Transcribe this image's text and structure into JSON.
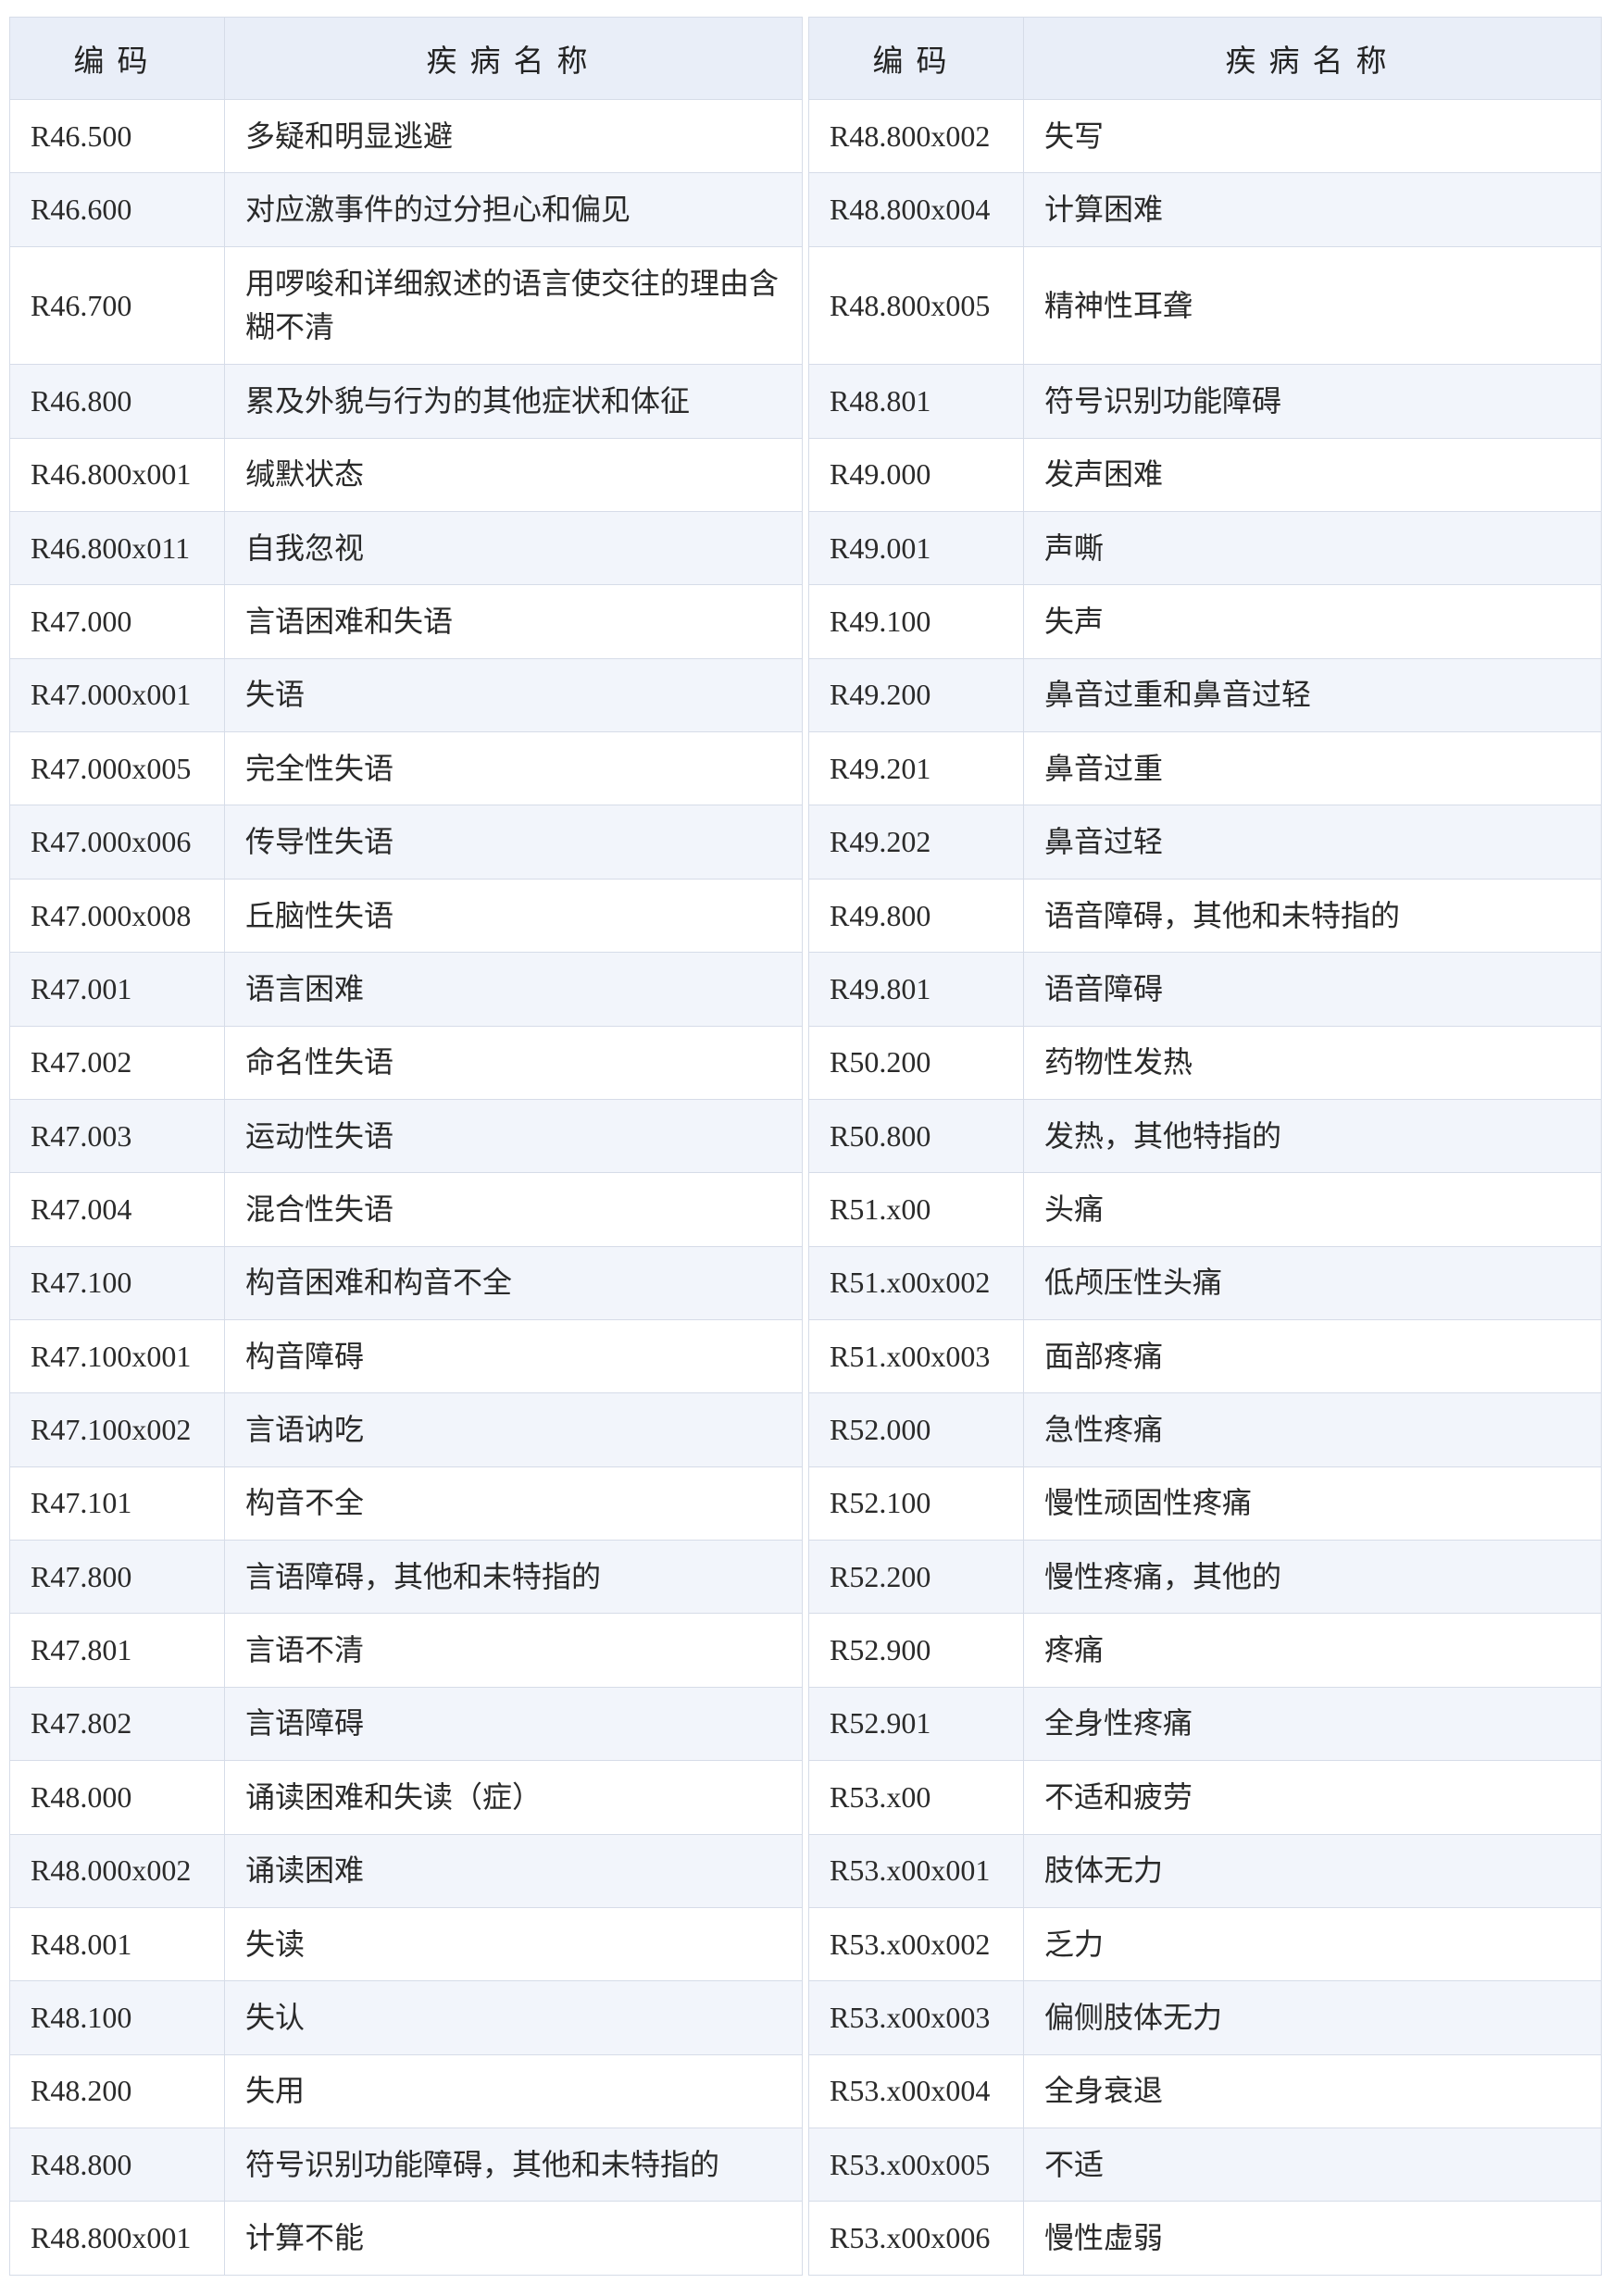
{
  "headers": {
    "code": "编码",
    "name": "疾病名称"
  },
  "left_rows": [
    {
      "code": "R46.500",
      "name": "多疑和明显逃避"
    },
    {
      "code": "R46.600",
      "name": "对应激事件的过分担心和偏见"
    },
    {
      "code": "R46.700",
      "name": "用啰唆和详细叙述的语言使交往的理由含糊不清",
      "tall": true
    },
    {
      "code": "R46.800",
      "name": "累及外貌与行为的其他症状和体征"
    },
    {
      "code": "R46.800x001",
      "name": "缄默状态"
    },
    {
      "code": "R46.800x011",
      "name": "自我忽视"
    },
    {
      "code": "R47.000",
      "name": "言语困难和失语"
    },
    {
      "code": "R47.000x001",
      "name": "失语"
    },
    {
      "code": "R47.000x005",
      "name": "完全性失语"
    },
    {
      "code": "R47.000x006",
      "name": "传导性失语"
    },
    {
      "code": "R47.000x008",
      "name": "丘脑性失语"
    },
    {
      "code": "R47.001",
      "name": "语言困难"
    },
    {
      "code": "R47.002",
      "name": "命名性失语"
    },
    {
      "code": "R47.003",
      "name": "运动性失语"
    },
    {
      "code": "R47.004",
      "name": "混合性失语"
    },
    {
      "code": "R47.100",
      "name": "构音困难和构音不全"
    },
    {
      "code": "R47.100x001",
      "name": "构音障碍"
    },
    {
      "code": "R47.100x002",
      "name": "言语讷吃"
    },
    {
      "code": "R47.101",
      "name": "构音不全"
    },
    {
      "code": "R47.800",
      "name": "言语障碍，其他和未特指的"
    },
    {
      "code": "R47.801",
      "name": "言语不清"
    },
    {
      "code": "R47.802",
      "name": "言语障碍"
    },
    {
      "code": "R48.000",
      "name": "诵读困难和失读（症）"
    },
    {
      "code": "R48.000x002",
      "name": "诵读困难"
    },
    {
      "code": "R48.001",
      "name": "失读"
    },
    {
      "code": "R48.100",
      "name": "失认"
    },
    {
      "code": "R48.200",
      "name": "失用"
    },
    {
      "code": "R48.800",
      "name": "符号识别功能障碍，其他和未特指的"
    },
    {
      "code": "R48.800x001",
      "name": "计算不能"
    }
  ],
  "right_rows": [
    {
      "code": "R48.800x002",
      "name": "失写"
    },
    {
      "code": "R48.800x004",
      "name": "计算困难"
    },
    {
      "code": "R48.800x005",
      "name": "精神性耳聋",
      "tall": true
    },
    {
      "code": "R48.801",
      "name": "符号识别功能障碍"
    },
    {
      "code": "R49.000",
      "name": "发声困难"
    },
    {
      "code": "R49.001",
      "name": "声嘶"
    },
    {
      "code": "R49.100",
      "name": "失声"
    },
    {
      "code": "R49.200",
      "name": "鼻音过重和鼻音过轻"
    },
    {
      "code": "R49.201",
      "name": "鼻音过重"
    },
    {
      "code": "R49.202",
      "name": "鼻音过轻"
    },
    {
      "code": "R49.800",
      "name": "语音障碍，其他和未特指的"
    },
    {
      "code": "R49.801",
      "name": "语音障碍"
    },
    {
      "code": "R50.200",
      "name": "药物性发热"
    },
    {
      "code": "R50.800",
      "name": "发热，其他特指的"
    },
    {
      "code": "R51.x00",
      "name": "头痛"
    },
    {
      "code": "R51.x00x002",
      "name": "低颅压性头痛"
    },
    {
      "code": "R51.x00x003",
      "name": "面部疼痛"
    },
    {
      "code": "R52.000",
      "name": "急性疼痛"
    },
    {
      "code": "R52.100",
      "name": "慢性顽固性疼痛"
    },
    {
      "code": "R52.200",
      "name": "慢性疼痛，其他的"
    },
    {
      "code": "R52.900",
      "name": "疼痛"
    },
    {
      "code": "R52.901",
      "name": "全身性疼痛"
    },
    {
      "code": "R53.x00",
      "name": "不适和疲劳"
    },
    {
      "code": "R53.x00x001",
      "name": "肢体无力"
    },
    {
      "code": "R53.x00x002",
      "name": "乏力"
    },
    {
      "code": "R53.x00x003",
      "name": "偏侧肢体无力"
    },
    {
      "code": "R53.x00x004",
      "name": "全身衰退"
    },
    {
      "code": "R53.x00x005",
      "name": "不适"
    },
    {
      "code": "R53.x00x006",
      "name": "慢性虚弱"
    }
  ]
}
